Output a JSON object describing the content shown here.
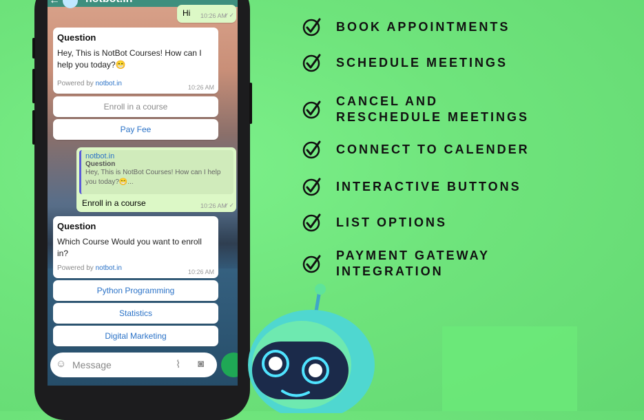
{
  "chat": {
    "title": "notbot.in",
    "outgoing_hi": {
      "text": "Hi",
      "time": "10:26 AM"
    },
    "message1": {
      "title": "Question",
      "body": "Hey, This is NotBot Courses! How can I help you today?😁",
      "powered_prefix": "Powered by",
      "powered_link": "notbot.in",
      "time": "10:26 AM"
    },
    "buttons1": [
      "Enroll in a course",
      "Pay Fee"
    ],
    "reply": {
      "quote_source": "notbot.in",
      "quote_title": "Question",
      "quote_body": "Hey, This is NotBot Courses! How can I help you today?😁...",
      "text": "Enroll in a course",
      "time": "10:26 AM"
    },
    "message2": {
      "title": "Question",
      "body": "Which Course Would you want to enroll in?",
      "powered_prefix": "Powered by",
      "powered_link": "notbot.in",
      "time": "10:26 AM"
    },
    "buttons2": [
      "Python Programming",
      "Statistics",
      "Digital Marketing"
    ],
    "input_placeholder": "Message"
  },
  "features": [
    "BOOK APPOINTMENTS",
    "SCHEDULE MEETINGS",
    "CANCEL AND RESCHEDULE MEETINGS",
    "CONNECT TO CALENDER",
    "INTERACTIVE BUTTONS",
    "LIST OPTIONS",
    "PAYMENT GATEWAY INTEGRATION"
  ],
  "icons": {
    "check": "check-circle-icon",
    "back": "back-arrow-icon",
    "emoji": "emoji-icon",
    "attach": "attach-icon",
    "camera": "camera-icon",
    "mic": "mic-icon"
  },
  "colors": {
    "background": "#6fe47c",
    "link": "#2a72c7",
    "outgoing_bubble": "#dcf8c6"
  }
}
